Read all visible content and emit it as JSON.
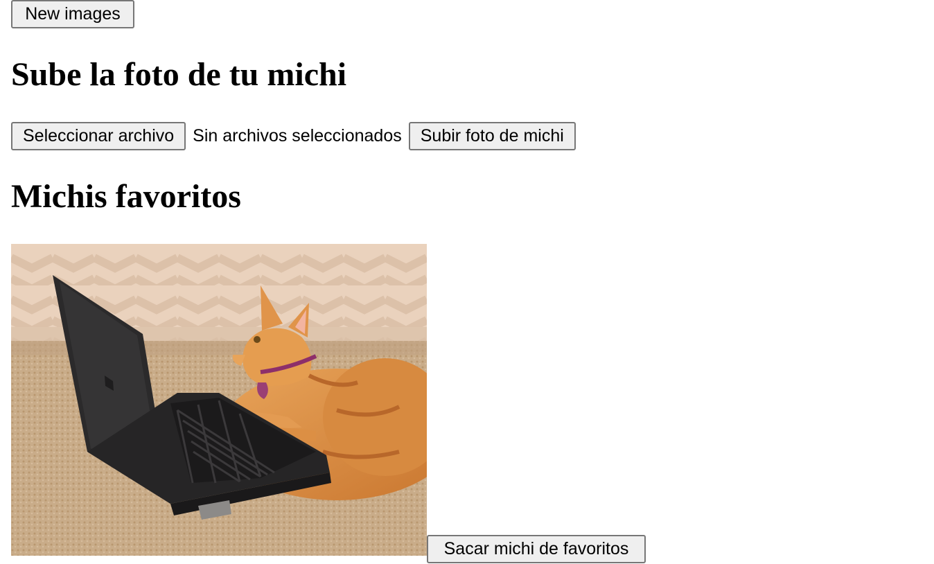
{
  "toolbar": {
    "new_images_label": "New images"
  },
  "upload_section": {
    "title": "Sube la foto de tu michi",
    "file_button_label": "Seleccionar archivo",
    "file_status": "Sin archivos seleccionados",
    "submit_label": "Subir foto de michi"
  },
  "favorites_section": {
    "title": "Michis favoritos",
    "items": [
      {
        "remove_label": "Sacar michi de favoritos"
      }
    ]
  }
}
